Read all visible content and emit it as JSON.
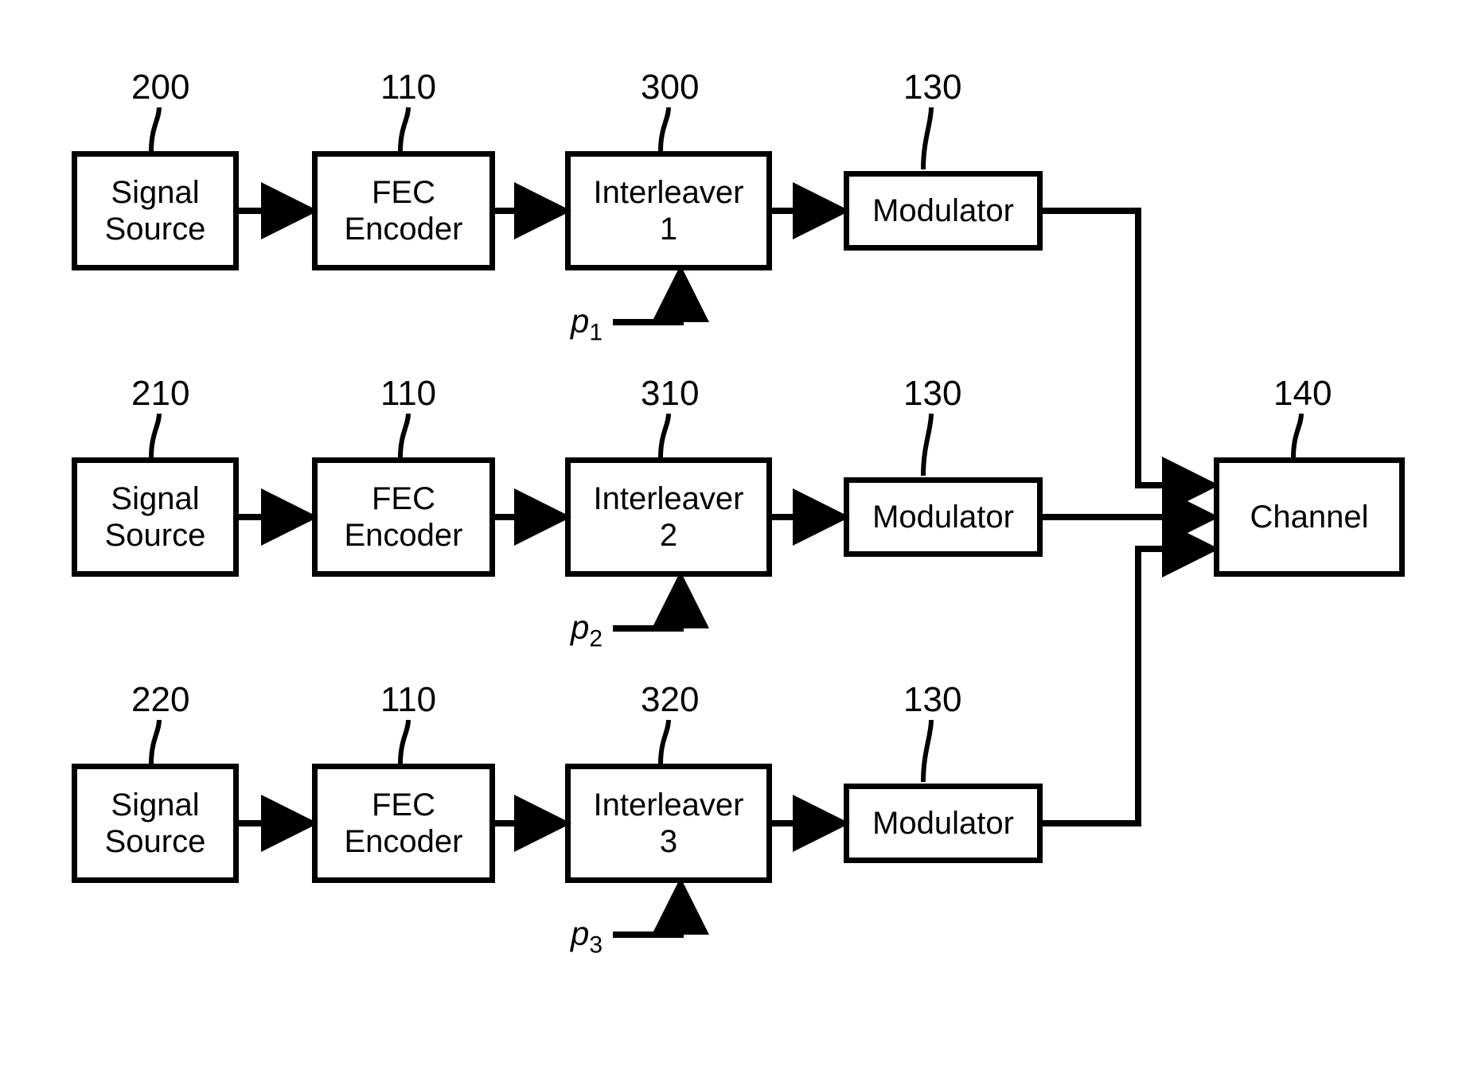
{
  "refs": {
    "r200": "200",
    "r210": "210",
    "r220": "220",
    "r110a": "110",
    "r110b": "110",
    "r110c": "110",
    "r300": "300",
    "r310": "310",
    "r320": "320",
    "r130a": "130",
    "r130b": "130",
    "r130c": "130",
    "r140": "140"
  },
  "blocks": {
    "src1_l1": "Signal",
    "src1_l2": "Source",
    "src2_l1": "Signal",
    "src2_l2": "Source",
    "src3_l1": "Signal",
    "src3_l2": "Source",
    "fec1_l1": "FEC",
    "fec1_l2": "Encoder",
    "fec2_l1": "FEC",
    "fec2_l2": "Encoder",
    "fec3_l1": "FEC",
    "fec3_l2": "Encoder",
    "intl1_l1": "Interleaver",
    "intl1_l2": "1",
    "intl2_l1": "Interleaver",
    "intl2_l2": "2",
    "intl3_l1": "Interleaver",
    "intl3_l2": "3",
    "mod1": "Modulator",
    "mod2": "Modulator",
    "mod3": "Modulator",
    "channel": "Channel"
  },
  "params": {
    "p1_sym": "p",
    "p1_sub": "1",
    "p2_sym": "p",
    "p2_sub": "2",
    "p3_sym": "p",
    "p3_sub": "3"
  }
}
